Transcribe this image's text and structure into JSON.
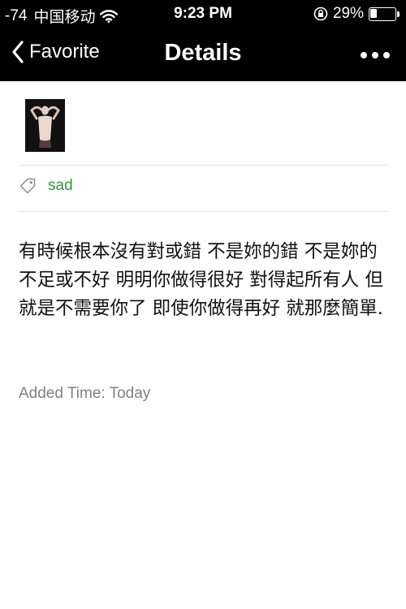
{
  "status_bar": {
    "signal": "-74",
    "carrier": "中国移动",
    "time": "9:23 PM",
    "battery_text": "29%",
    "battery_level": 0.29
  },
  "nav": {
    "back_label": "Favorite",
    "title": "Details"
  },
  "tag": {
    "label": "sad"
  },
  "content": {
    "text": "有時候根本沒有對或錯 不是妳的錯 不是妳的不足或不好 明明你做得很好 對得起所有人 但就是不需要你了 即使你做得再好 就那麼簡單.",
    "added_time": "Added Time: Today"
  },
  "colors": {
    "bar_background": "#000000",
    "tag_green": "#2f9a3c",
    "meta_gray": "#808080"
  },
  "icons": {
    "wifi": "wifi-icon",
    "rotation_lock": "rotation-lock-icon",
    "battery": "battery-icon",
    "back": "chevron-left-icon",
    "more": "more-icon",
    "tag": "tag-icon"
  }
}
